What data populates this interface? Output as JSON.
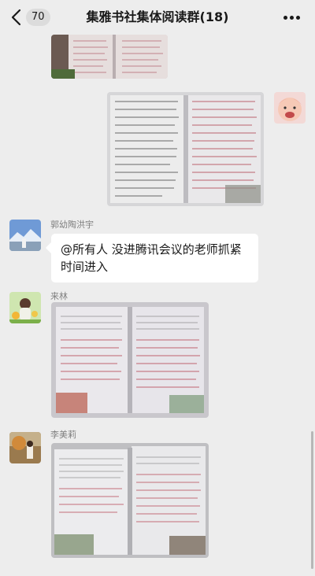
{
  "header": {
    "back_icon": "chevron-left-icon",
    "unread_count": "70",
    "title": "集雅书社集体阅读群(18)",
    "more_icon": "more-dots-icon"
  },
  "messages": [
    {
      "type": "image",
      "side": "left",
      "sender": "",
      "content": "handwritten notebook page photo (partially scrolled off)"
    },
    {
      "type": "image",
      "side": "right",
      "sender": "",
      "content": "handwritten notebook pages photo"
    },
    {
      "type": "text",
      "side": "left",
      "sender": "郭幼陶洪宇",
      "text": "@所有人 没进腾讯会议的老师抓紧时间进入"
    },
    {
      "type": "image",
      "side": "left",
      "sender": "来林",
      "content": "open book with notes photo"
    },
    {
      "type": "image",
      "side": "left",
      "sender": "李美莉",
      "content": "open book with notes photo"
    }
  ],
  "colors": {
    "background": "#ededed",
    "bubble": "#ffffff",
    "name_text": "#7f7f7f",
    "primary_text": "#191919"
  }
}
